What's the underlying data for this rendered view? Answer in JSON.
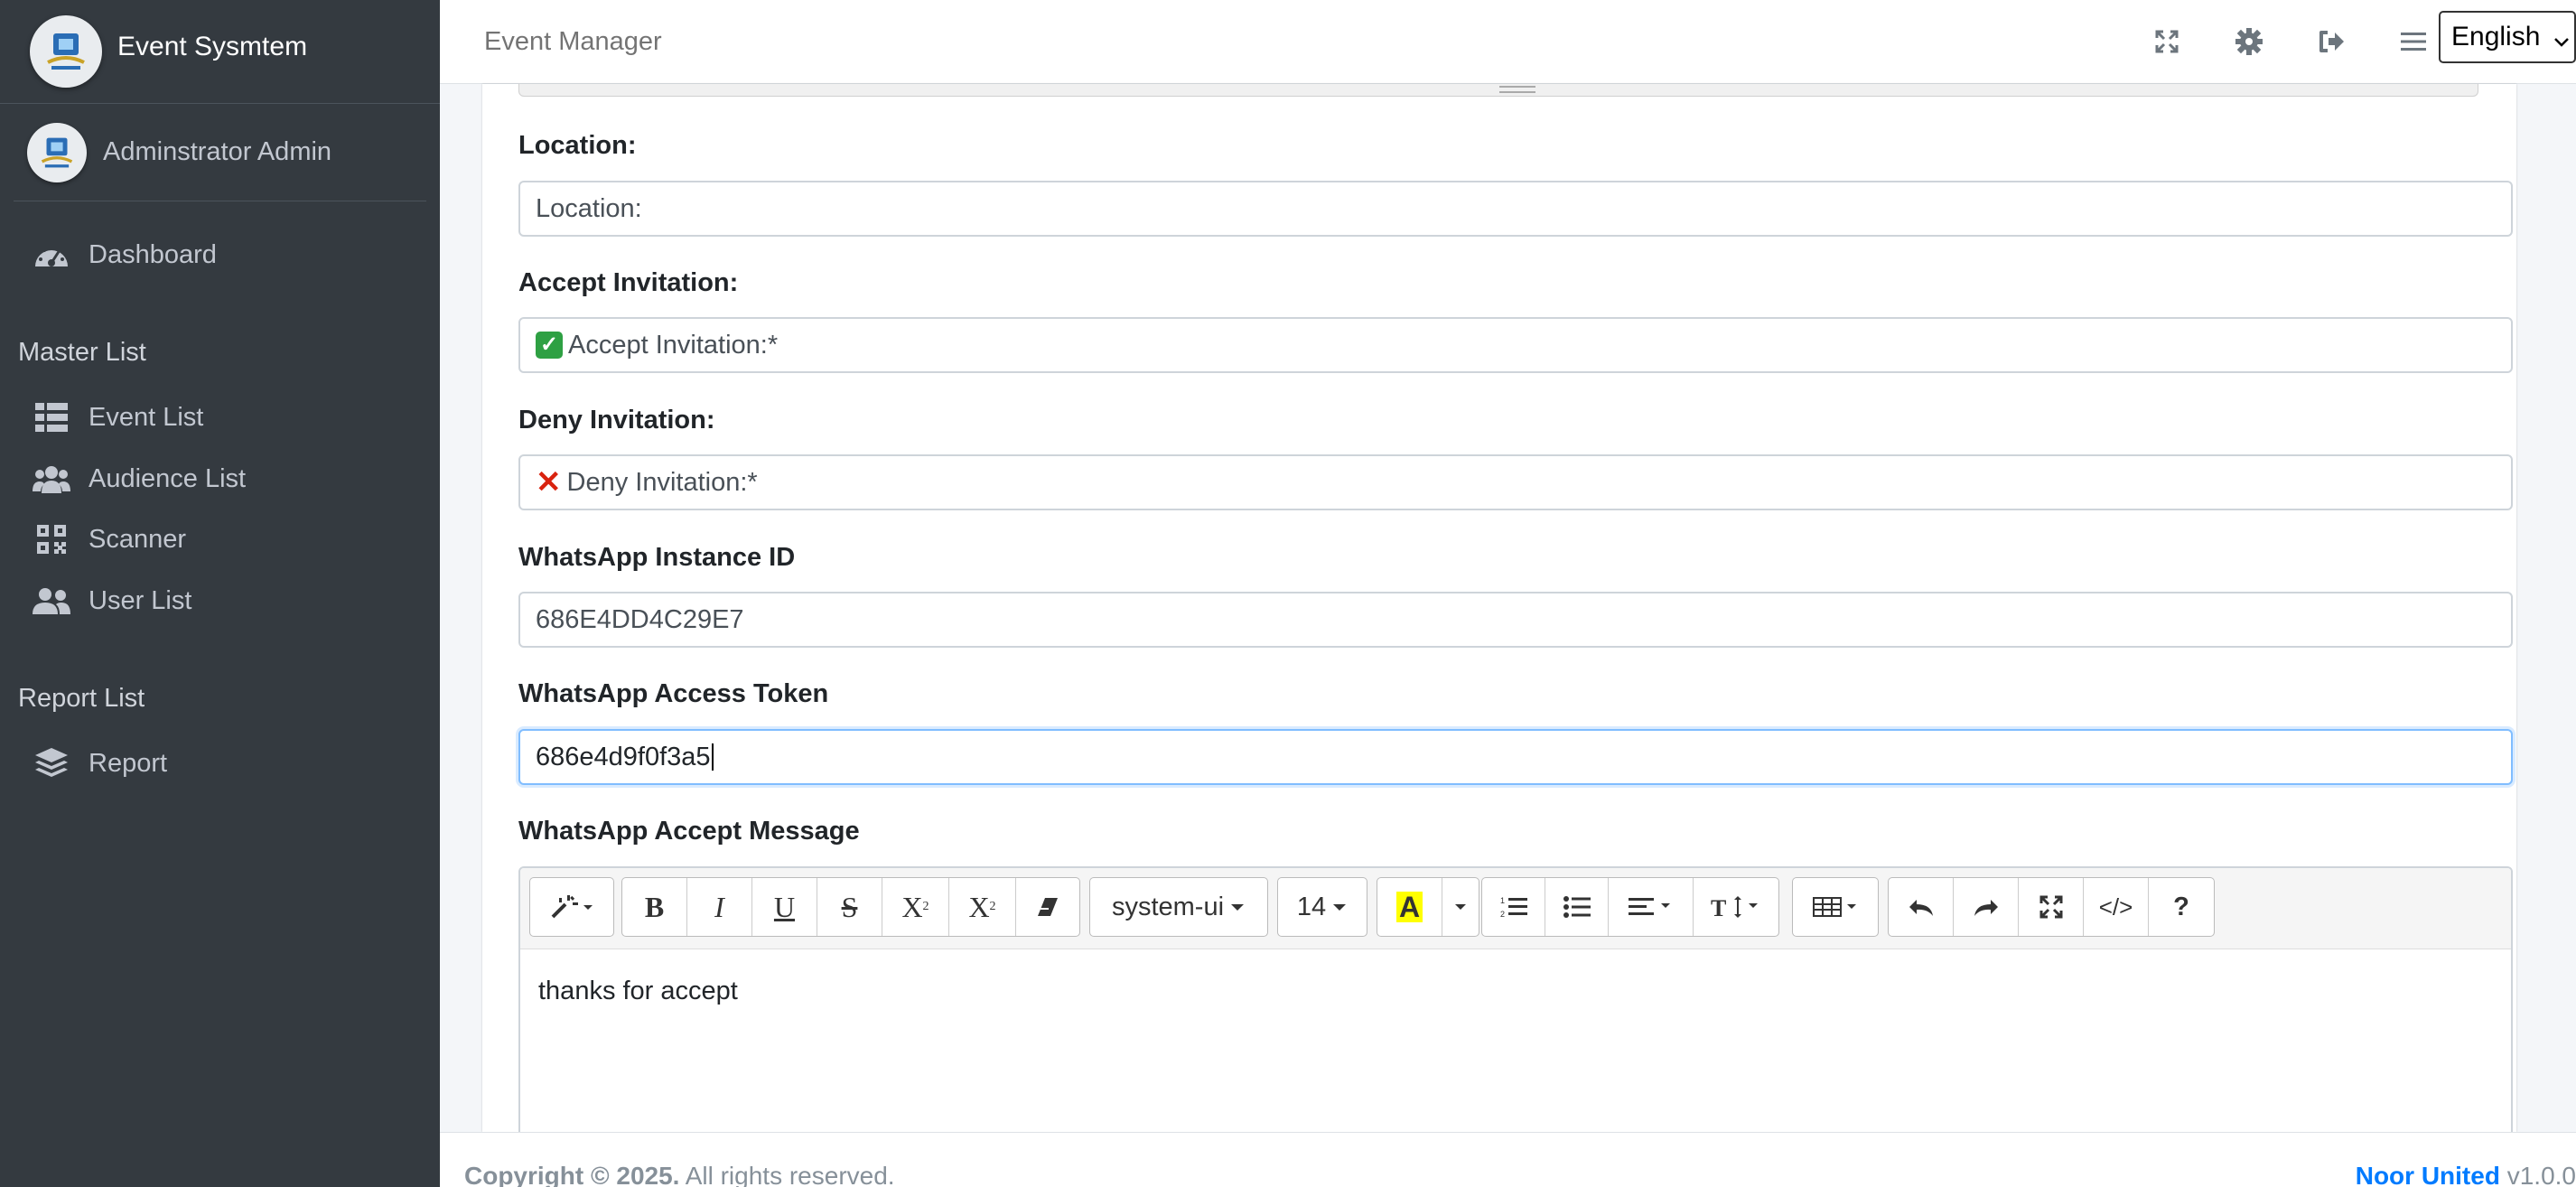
{
  "sidebar": {
    "brand": "Event Sysmtem",
    "user": "Adminstrator Admin",
    "dashboard": "Dashboard",
    "master_header": "Master List",
    "items": [
      {
        "label": "Event List",
        "icon": "list-icon"
      },
      {
        "label": "Audience List",
        "icon": "users-icon"
      },
      {
        "label": "Scanner",
        "icon": "qrcode-icon"
      },
      {
        "label": "User List",
        "icon": "user-friends-icon"
      }
    ],
    "report_header": "Report List",
    "report": "Report"
  },
  "navbar": {
    "title": "Event Manager",
    "language": "English"
  },
  "form": {
    "location": {
      "label": "Location:",
      "placeholder": "Location:"
    },
    "accept": {
      "label": "Accept Invitation:",
      "value": "Accept Invitation:*"
    },
    "deny": {
      "label": "Deny Invitation:",
      "value": "Deny Invitation:*"
    },
    "instance": {
      "label": "WhatsApp Instance ID",
      "value": "686E4DD4C29E7"
    },
    "token": {
      "label": "WhatsApp Access Token",
      "value": "686e4d9f0f3a5"
    },
    "accept_message": {
      "label": "WhatsApp Accept Message",
      "body": "thanks for accept"
    }
  },
  "editor_toolbar": {
    "font_name": "system-ui",
    "font_size": "14"
  },
  "footer": {
    "copyright": "Copyright © 2025.",
    "rights": " All rights reserved.",
    "company": "Noor United",
    "version": " v1.0.0"
  }
}
